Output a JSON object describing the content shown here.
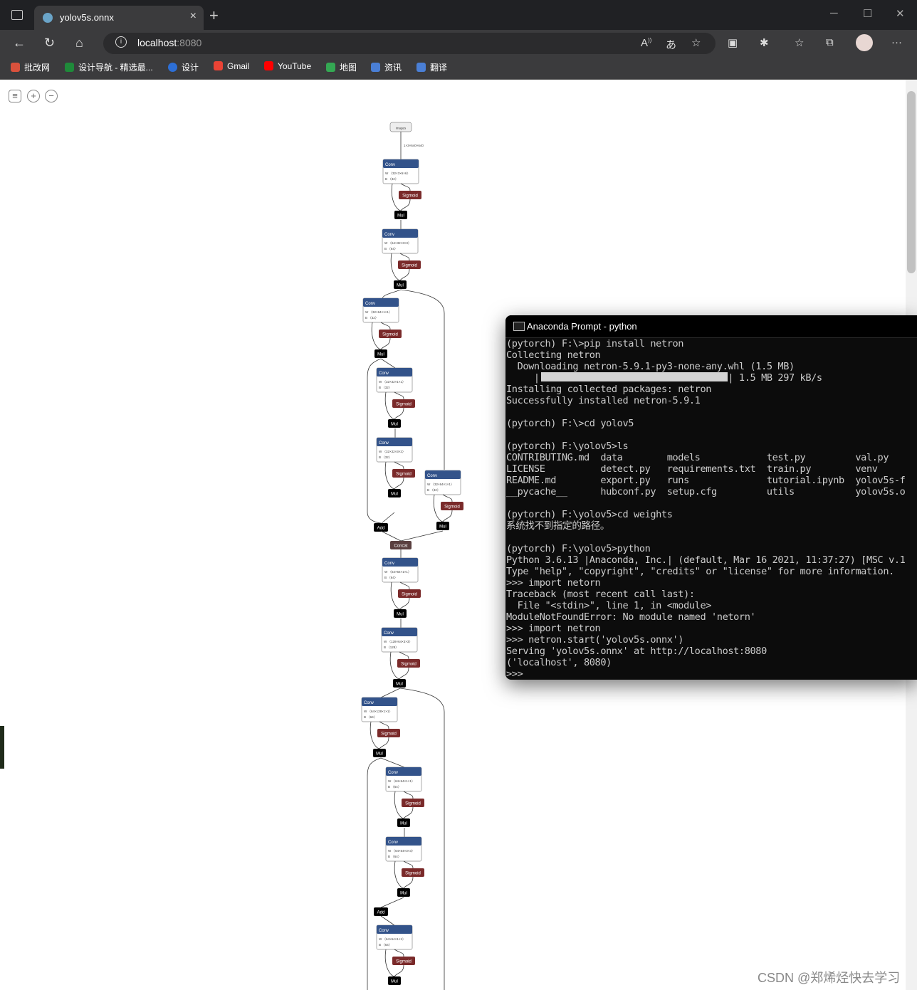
{
  "browser": {
    "tab_title": "yolov5s.onnx",
    "tab_close": "×",
    "new_tab": "+",
    "url_host": "localhost",
    "url_port": ":8080"
  },
  "bookmarks": [
    {
      "label": "批改网",
      "color": "#d9513c"
    },
    {
      "label": "设计导航 - 精选最...",
      "color": "#1f8a3a"
    },
    {
      "label": "设计",
      "color": "#2d6fd6"
    },
    {
      "label": "Gmail",
      "color": "#ea4335"
    },
    {
      "label": "YouTube",
      "color": "#ff0000"
    },
    {
      "label": "地图",
      "color": "#34a853"
    },
    {
      "label": "资讯",
      "color": "#4a7fd6"
    },
    {
      "label": "翻译",
      "color": "#4a7fd6"
    }
  ],
  "graph": {
    "input": "images",
    "input_shape": "1×3×640×640",
    "labels": {
      "conv": "Conv",
      "sigmoid": "Sigmoid",
      "mul": "Mul",
      "add": "Add",
      "concat": "Concat"
    },
    "convs": [
      {
        "w": "W 〈32×3×6×6〉",
        "b": "B 〈32〉"
      },
      {
        "w": "W 〈64×32×3×3〉",
        "b": "B 〈64〉"
      },
      {
        "w": "W 〈32×64×1×1〉",
        "b": "B 〈32〉"
      },
      {
        "w": "W 〈32×32×1×1〉",
        "b": "B 〈32〉"
      },
      {
        "w": "W 〈32×32×3×3〉",
        "b": "B 〈32〉"
      },
      {
        "w": "W 〈32×64×1×1〉",
        "b": "B 〈32〉"
      },
      {
        "w": "W 〈64×64×1×1〉",
        "b": "B 〈64〉"
      },
      {
        "w": "W 〈128×64×3×3〉",
        "b": "B 〈128〉"
      },
      {
        "w": "W 〈64×128×1×1〉",
        "b": "B 〈64〉"
      },
      {
        "w": "W 〈64×64×1×1〉",
        "b": "B 〈64〉"
      },
      {
        "w": "W 〈64×64×3×3〉",
        "b": "B 〈64〉"
      },
      {
        "w": "W 〈64×64×1×1〉",
        "b": "B 〈64〉"
      }
    ]
  },
  "terminal": {
    "title": "Anaconda Prompt - python",
    "lines": [
      "(pytorch) F:\\>pip install netron",
      "Collecting netron",
      "  Downloading netron-5.9.1-py3-none-any.whl (1.5 MB)",
      "     |                                  | 1.5 MB 297 kB/s",
      "Installing collected packages: netron",
      "Successfully installed netron-5.9.1",
      "",
      "(pytorch) F:\\>cd yolov5",
      "",
      "(pytorch) F:\\yolov5>ls",
      "CONTRIBUTING.md  data        models            test.py         val.py",
      "LICENSE          detect.py   requirements.txt  train.py        venv",
      "README.md        export.py   runs              tutorial.ipynb  yolov5s-f",
      "__pycache__      hubconf.py  setup.cfg         utils           yolov5s.o",
      "",
      "(pytorch) F:\\yolov5>cd weights",
      "系统找不到指定的路径。",
      "",
      "(pytorch) F:\\yolov5>python",
      "Python 3.6.13 |Anaconda, Inc.| (default, Mar 16 2021, 11:37:27) [MSC v.1",
      "Type \"help\", \"copyright\", \"credits\" or \"license\" for more information.",
      ">>> import netorn",
      "Traceback (most recent call last):",
      "  File \"<stdin>\", line 1, in <module>",
      "ModuleNotFoundError: No module named 'netorn'",
      ">>> import netron",
      ">>> netron.start('yolov5s.onnx')",
      "Serving 'yolov5s.onnx' at http://localhost:8080",
      "('localhost', 8080)",
      ">>>"
    ]
  },
  "watermark": "CSDN @郑烯烃快去学习"
}
